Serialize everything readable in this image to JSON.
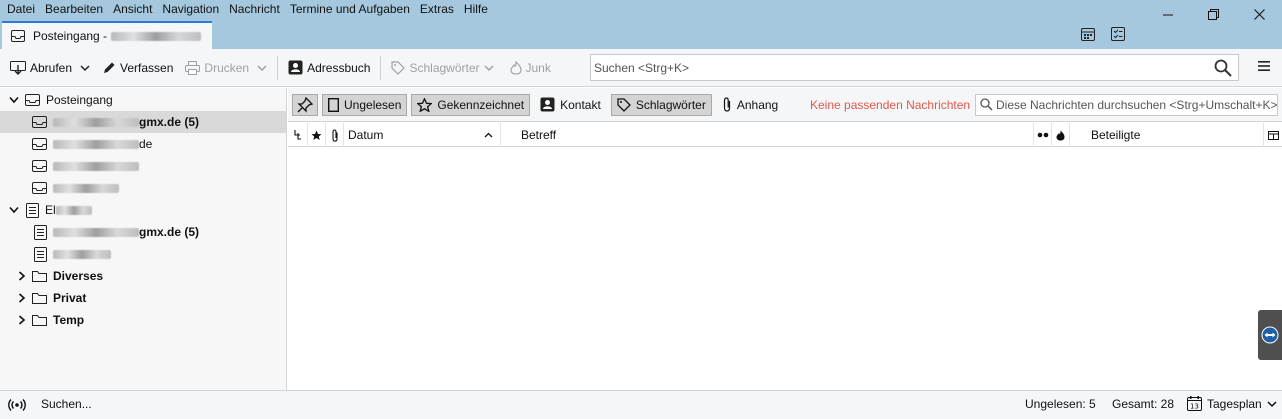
{
  "menu": {
    "items": [
      {
        "label": "Datei"
      },
      {
        "label": "Bearbeiten"
      },
      {
        "label": "Ansicht"
      },
      {
        "label": "Navigation"
      },
      {
        "label": "Nachricht"
      },
      {
        "label": "Termine und Aufgaben"
      },
      {
        "label": "Extras"
      },
      {
        "label": "Hilfe"
      }
    ]
  },
  "tab": {
    "label": "Posteingang -"
  },
  "toolbar": {
    "get_messages": "Abrufen",
    "write": "Verfassen",
    "print": "Drucken",
    "address_book": "Adressbuch",
    "tags": "Schlagwörter",
    "junk": "Junk"
  },
  "search": {
    "placeholder": "Suchen <Strg+K>"
  },
  "folders": {
    "account1": {
      "inbox_label": "Posteingang",
      "sub1_suffix": "gmx.de (5)",
      "sub2_suffix": "de"
    },
    "account2": {
      "label_prefix": "El",
      "sub1_suffix": "gmx.de (5)"
    },
    "diverses": "Diverses",
    "privat": "Privat",
    "temp": "Temp"
  },
  "filterbar": {
    "unread": "Ungelesen",
    "starred": "Gekennzeichnet",
    "contact": "Kontakt",
    "tags": "Schlagwörter",
    "attachment": "Anhang",
    "no_match": "Keine passenden Nachrichten",
    "search_placeholder": "Diese Nachrichten durchsuchen <Strg+Umschalt+K>"
  },
  "columns": {
    "date": "Datum",
    "subject": "Betreff",
    "participants": "Beteiligte"
  },
  "status": {
    "searching": "Suchen...",
    "unread": "Ungelesen: 5",
    "total": "Gesamt: 28",
    "today_pane": "Tagesplan"
  },
  "colors": {
    "titlebar": "#a6c8de",
    "toolbar": "#f5f6f7",
    "tab_accent": "#2b7bd6",
    "no_match_text": "#e0584c",
    "selected_row": "#d9d9d9"
  }
}
